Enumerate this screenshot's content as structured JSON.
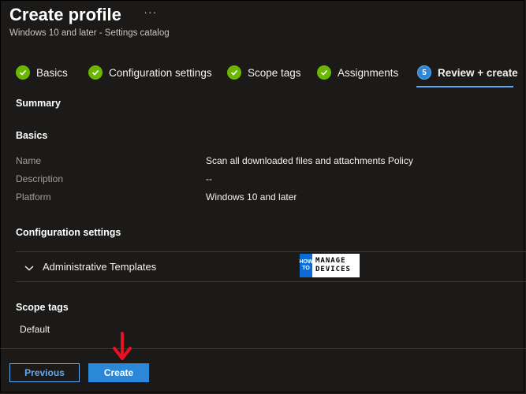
{
  "header": {
    "title": "Create profile",
    "more_icon": "···",
    "subtitle": "Windows 10 and later - Settings catalog"
  },
  "steps": [
    {
      "label": "Basics",
      "state": "complete"
    },
    {
      "label": "Configuration settings",
      "state": "complete"
    },
    {
      "label": "Scope tags",
      "state": "complete"
    },
    {
      "label": "Assignments",
      "state": "complete"
    },
    {
      "label": "Review + create",
      "state": "active",
      "number": "5"
    }
  ],
  "summary": {
    "heading": "Summary",
    "basics": {
      "heading": "Basics",
      "rows": [
        {
          "label": "Name",
          "value": "Scan all downloaded files and attachments Policy"
        },
        {
          "label": "Description",
          "value": "--"
        },
        {
          "label": "Platform",
          "value": "Windows 10 and later"
        }
      ]
    },
    "configuration": {
      "heading": "Configuration settings",
      "accordion_label": "Administrative Templates"
    },
    "scope_tags": {
      "heading": "Scope tags",
      "value": "Default"
    }
  },
  "watermark": {
    "how": "HOW",
    "to": "TO",
    "line1": "MANAGE",
    "line2": "DEVICES"
  },
  "footer": {
    "previous_label": "Previous",
    "create_label": "Create"
  },
  "colors": {
    "background": "#1b1a19",
    "accent": "#2b88d8",
    "success": "#6bb700",
    "annotation_arrow": "#e81123"
  }
}
